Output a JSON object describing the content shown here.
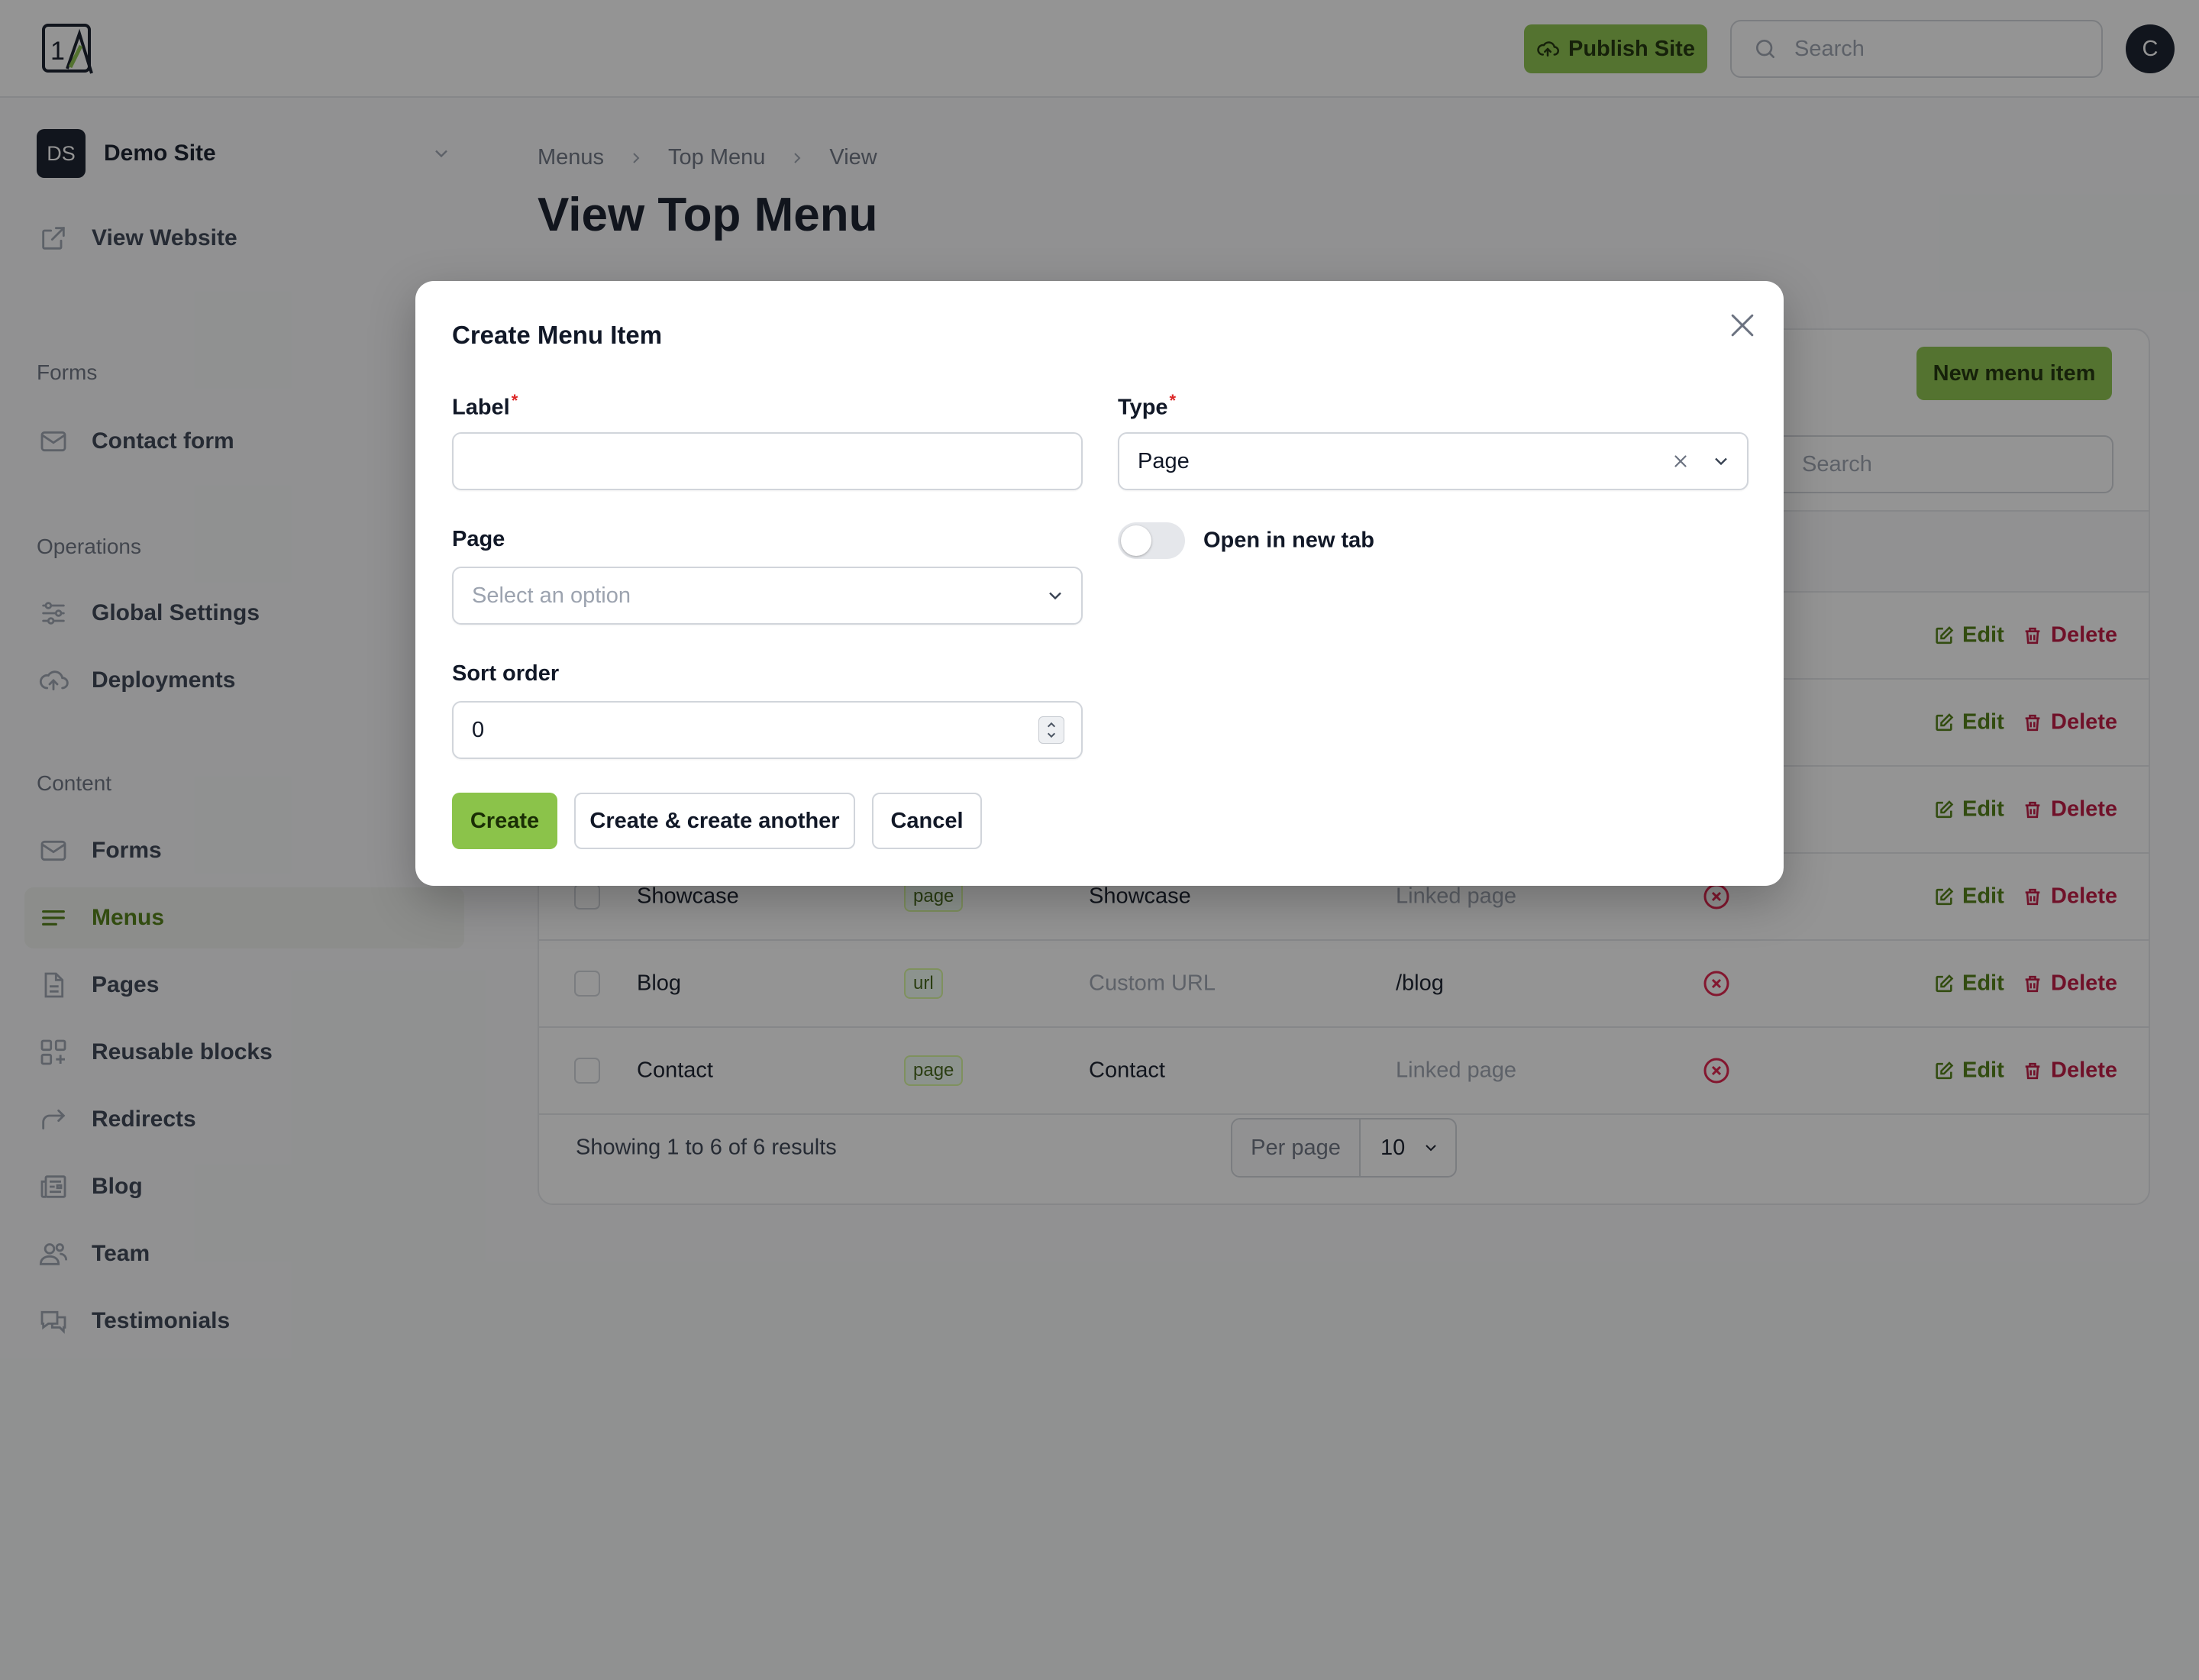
{
  "header": {
    "publish_label": "Publish Site",
    "search_placeholder": "Search",
    "avatar_initial": "C"
  },
  "sidebar": {
    "site": {
      "initials": "DS",
      "name": "Demo Site"
    },
    "view_website": "View Website",
    "groups": {
      "forms": "Forms",
      "operations": "Operations",
      "content": "Content"
    },
    "items": {
      "contact_form": "Contact form",
      "global_settings": "Global Settings",
      "deployments": "Deployments",
      "forms": "Forms",
      "menus": "Menus",
      "pages": "Pages",
      "reusable_blocks": "Reusable blocks",
      "redirects": "Redirects",
      "blog": "Blog",
      "team": "Team",
      "testimonials": "Testimonials"
    },
    "active_item": "menus"
  },
  "breadcrumb": [
    "Menus",
    "Top Menu",
    "View"
  ],
  "page_title": "View Top Menu",
  "table": {
    "new_item_label": "New menu item",
    "search_placeholder": "Search",
    "rows": [
      {
        "label": "Showcase",
        "type": "page",
        "page": "Showcase",
        "url": "Linked page"
      },
      {
        "label": "Blog",
        "type": "url",
        "page": "Custom URL",
        "url": "/blog"
      },
      {
        "label": "Contact",
        "type": "page",
        "page": "Contact",
        "url": "Linked page"
      }
    ],
    "action_edit": "Edit",
    "action_delete": "Delete",
    "footer_text": "Showing 1 to 6 of 6 results",
    "per_page_label": "Per page",
    "per_page_value": "10"
  },
  "modal": {
    "title": "Create Menu Item",
    "label_field": {
      "label": "Label",
      "required_mark": "*",
      "value": ""
    },
    "type_field": {
      "label": "Type",
      "required_mark": "*",
      "value": "Page"
    },
    "page_field": {
      "label": "Page",
      "placeholder": "Select an option"
    },
    "open_new_tab": {
      "label": "Open in new tab",
      "enabled": false
    },
    "sort_order": {
      "label": "Sort order",
      "value": "0"
    },
    "buttons": {
      "create": "Create",
      "create_another": "Create & create another",
      "cancel": "Cancel"
    }
  },
  "colors": {
    "accent": "#8bc34a",
    "accent_text": "#4d7c0f",
    "danger": "#be123c",
    "overlay": "rgba(17,17,17,0.45)"
  }
}
